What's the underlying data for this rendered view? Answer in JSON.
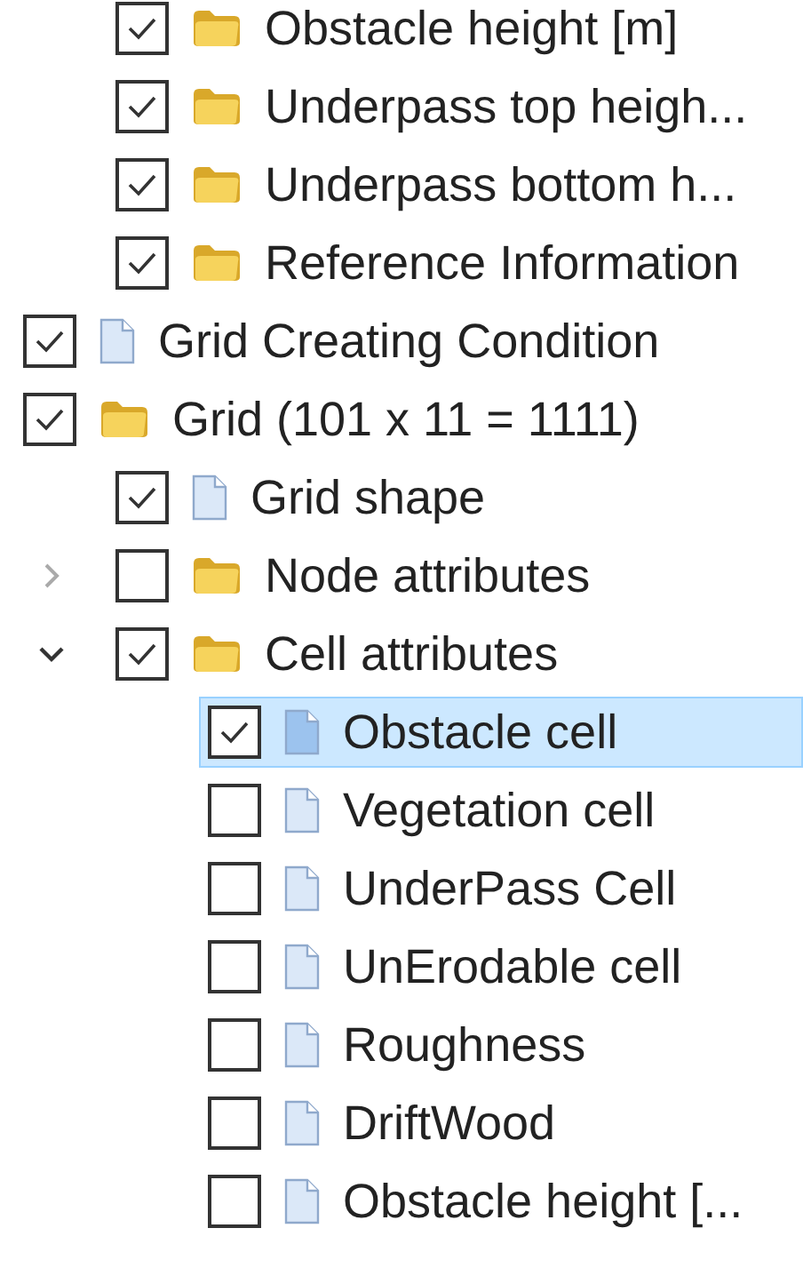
{
  "tree": [
    {
      "children": [
        {
          "label": "Obstacle height [m]",
          "kind": "folder",
          "checked": true,
          "selected": false
        },
        {
          "label": "Underpass top heigh...",
          "kind": "folder",
          "checked": true,
          "selected": false
        },
        {
          "label": "Underpass bottom h...",
          "kind": "folder",
          "checked": true,
          "selected": false
        },
        {
          "label": "Reference Information",
          "kind": "folder",
          "checked": true,
          "selected": false
        }
      ]
    },
    {
      "label": "Grid Creating Condition",
      "kind": "file",
      "checked": true,
      "selected": false
    },
    {
      "label": "Grid (101 x 11 = 1111)",
      "kind": "folder",
      "checked": true,
      "selected": false,
      "children": [
        {
          "label": "Grid shape",
          "kind": "file",
          "checked": true,
          "selected": false
        },
        {
          "label": "Node attributes",
          "kind": "folder",
          "checked": false,
          "selected": false,
          "expanded": false
        },
        {
          "label": "Cell attributes",
          "kind": "folder",
          "checked": true,
          "selected": false,
          "expanded": true,
          "children": [
            {
              "label": "Obstacle cell",
              "kind": "file",
              "checked": true,
              "selected": true
            },
            {
              "label": "Vegetation cell",
              "kind": "file",
              "checked": false,
              "selected": false
            },
            {
              "label": "UnderPass Cell",
              "kind": "file",
              "checked": false,
              "selected": false
            },
            {
              "label": "UnErodable cell",
              "kind": "file",
              "checked": false,
              "selected": false
            },
            {
              "label": "Roughness",
              "kind": "file",
              "checked": false,
              "selected": false
            },
            {
              "label": "DriftWood",
              "kind": "file",
              "checked": false,
              "selected": false
            },
            {
              "label": "Obstacle height [...",
              "kind": "file",
              "checked": false,
              "selected": false
            }
          ]
        }
      ]
    }
  ]
}
